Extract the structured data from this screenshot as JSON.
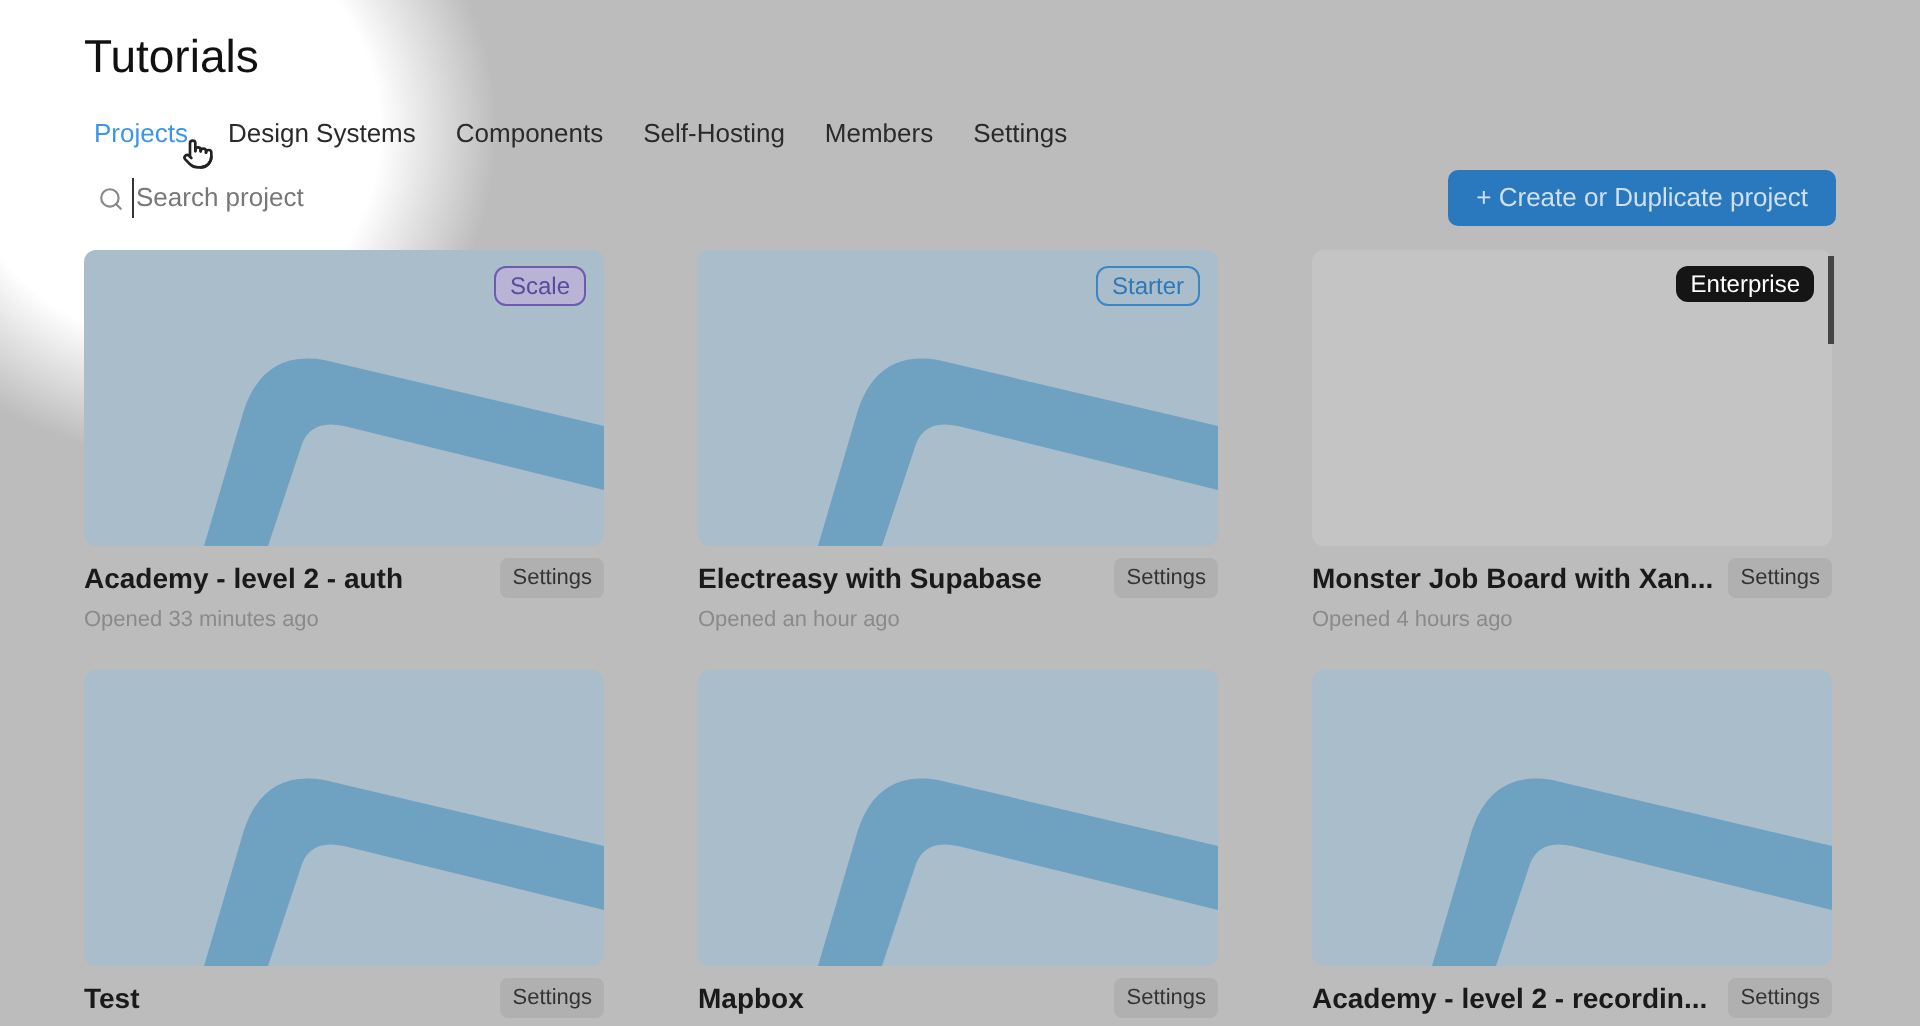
{
  "title": "Tutorials",
  "tabs": [
    {
      "label": "Projects",
      "selected": true
    },
    {
      "label": "Design Systems",
      "selected": false
    },
    {
      "label": "Components",
      "selected": false
    },
    {
      "label": "Self-Hosting",
      "selected": false
    },
    {
      "label": "Members",
      "selected": false
    },
    {
      "label": "Settings",
      "selected": false
    }
  ],
  "search": {
    "placeholder": "Search project"
  },
  "create_button": "+ Create or Duplicate project",
  "projects": [
    {
      "name": "Academy - level 2 - auth",
      "opened": "Opened 33 minutes ago",
      "plan": {
        "kind": "scale",
        "label": "Scale"
      },
      "has_graphic": true,
      "settings": "Settings"
    },
    {
      "name": "Electreasy with Supabase",
      "opened": "Opened an hour ago",
      "plan": {
        "kind": "starter",
        "label": "Starter"
      },
      "has_graphic": true,
      "settings": "Settings"
    },
    {
      "name": "Monster Job Board with Xan...",
      "opened": "Opened 4 hours ago",
      "plan": {
        "kind": "enterprise",
        "label": "Enterprise"
      },
      "has_graphic": false,
      "settings": "Settings"
    },
    {
      "name": "Test",
      "has_graphic": true,
      "settings": "Settings"
    },
    {
      "name": "Mapbox",
      "has_graphic": true,
      "settings": "Settings"
    },
    {
      "name": "Academy - level 2 - recordin...",
      "has_graphic": true,
      "settings": "Settings"
    }
  ]
}
